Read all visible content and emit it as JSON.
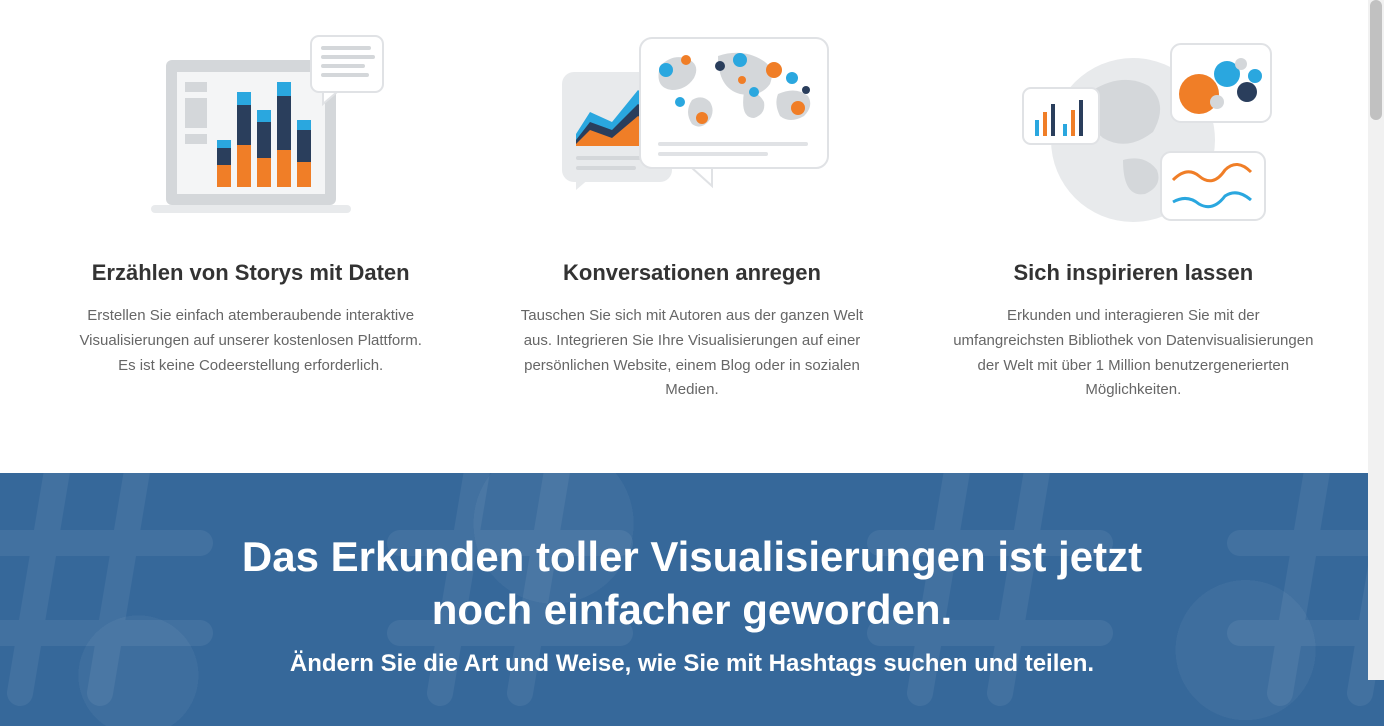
{
  "features": [
    {
      "title": "Erzählen von Storys mit Daten",
      "description": "Erstellen Sie einfach atemberaubende interaktive Visualisierungen auf unserer kostenlosen Plattform. Es ist keine Codeerstellung erforderlich."
    },
    {
      "title": "Konversationen anregen",
      "description": "Tauschen Sie sich mit Autoren aus der ganzen Welt aus. Integrieren Sie Ihre Visualisierungen auf einer persönlichen Website, einem Blog oder in sozialen Medien."
    },
    {
      "title": "Sich inspirieren lassen",
      "description": "Erkunden und interagieren Sie mit der umfangreichsten Bibliothek von Datenvisualisierungen der Welt mit über 1 Million benutzergenerierten Möglichkeiten."
    }
  ],
  "banner": {
    "title": "Das Erkunden toller Visualisierungen ist jetzt noch einfacher geworden.",
    "subtitle": "Ändern Sie die Art und Weise, wie Sie mit Hashtags suchen und teilen."
  },
  "colors": {
    "orange": "#f07e27",
    "blue": "#2aa7df",
    "darkblue": "#2a3e5c",
    "gray": "#d4d7da",
    "lightgray": "#e8eaec",
    "banner": "#36689a"
  }
}
